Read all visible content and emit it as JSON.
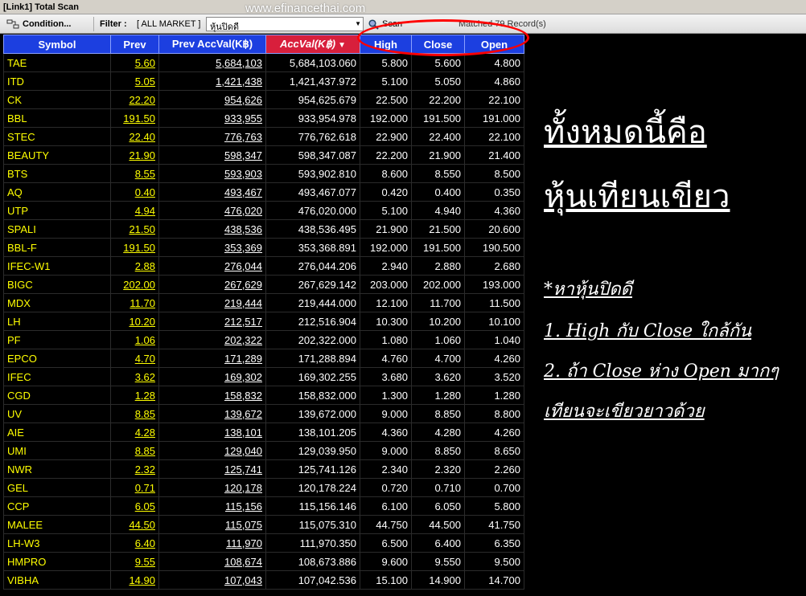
{
  "window": {
    "title": "[Link1] Total Scan"
  },
  "watermark": "www.efinancethai.com",
  "toolbar": {
    "condition_label": "Condition...",
    "filter_label": "Filter :",
    "filter_value": "[ ALL MARKET ]",
    "preset_value": "หุ้นปิดดี",
    "scan_label": "Scan",
    "matched_text": "Matched 79 Record(s)"
  },
  "columns": [
    "Symbol",
    "Prev",
    "Prev AccVal(K฿)",
    "AccVal(K฿)",
    "High",
    "Close",
    "Open"
  ],
  "rows": [
    [
      "TAE",
      "5.60",
      "5,684,103",
      "5,684,103.060",
      "5.800",
      "5.600",
      "4.800"
    ],
    [
      "ITD",
      "5.05",
      "1,421,438",
      "1,421,437.972",
      "5.100",
      "5.050",
      "4.860"
    ],
    [
      "CK",
      "22.20",
      "954,626",
      "954,625.679",
      "22.500",
      "22.200",
      "22.100"
    ],
    [
      "BBL",
      "191.50",
      "933,955",
      "933,954.978",
      "192.000",
      "191.500",
      "191.000"
    ],
    [
      "STEC",
      "22.40",
      "776,763",
      "776,762.618",
      "22.900",
      "22.400",
      "22.100"
    ],
    [
      "BEAUTY",
      "21.90",
      "598,347",
      "598,347.087",
      "22.200",
      "21.900",
      "21.400"
    ],
    [
      "BTS",
      "8.55",
      "593,903",
      "593,902.810",
      "8.600",
      "8.550",
      "8.500"
    ],
    [
      "AQ",
      "0.40",
      "493,467",
      "493,467.077",
      "0.420",
      "0.400",
      "0.350"
    ],
    [
      "UTP",
      "4.94",
      "476,020",
      "476,020.000",
      "5.100",
      "4.940",
      "4.360"
    ],
    [
      "SPALI",
      "21.50",
      "438,536",
      "438,536.495",
      "21.900",
      "21.500",
      "20.600"
    ],
    [
      "BBL-F",
      "191.50",
      "353,369",
      "353,368.891",
      "192.000",
      "191.500",
      "190.500"
    ],
    [
      "IFEC-W1",
      "2.88",
      "276,044",
      "276,044.206",
      "2.940",
      "2.880",
      "2.680"
    ],
    [
      "BIGC",
      "202.00",
      "267,629",
      "267,629.142",
      "203.000",
      "202.000",
      "193.000"
    ],
    [
      "MDX",
      "11.70",
      "219,444",
      "219,444.000",
      "12.100",
      "11.700",
      "11.500"
    ],
    [
      "LH",
      "10.20",
      "212,517",
      "212,516.904",
      "10.300",
      "10.200",
      "10.100"
    ],
    [
      "PF",
      "1.06",
      "202,322",
      "202,322.000",
      "1.080",
      "1.060",
      "1.040"
    ],
    [
      "EPCO",
      "4.70",
      "171,289",
      "171,288.894",
      "4.760",
      "4.700",
      "4.260"
    ],
    [
      "IFEC",
      "3.62",
      "169,302",
      "169,302.255",
      "3.680",
      "3.620",
      "3.520"
    ],
    [
      "CGD",
      "1.28",
      "158,832",
      "158,832.000",
      "1.300",
      "1.280",
      "1.280"
    ],
    [
      "UV",
      "8.85",
      "139,672",
      "139,672.000",
      "9.000",
      "8.850",
      "8.800"
    ],
    [
      "AIE",
      "4.28",
      "138,101",
      "138,101.205",
      "4.360",
      "4.280",
      "4.260"
    ],
    [
      "UMI",
      "8.85",
      "129,040",
      "129,039.950",
      "9.000",
      "8.850",
      "8.650"
    ],
    [
      "NWR",
      "2.32",
      "125,741",
      "125,741.126",
      "2.340",
      "2.320",
      "2.260"
    ],
    [
      "GEL",
      "0.71",
      "120,178",
      "120,178.224",
      "0.720",
      "0.710",
      "0.700"
    ],
    [
      "CCP",
      "6.05",
      "115,156",
      "115,156.146",
      "6.100",
      "6.050",
      "5.800"
    ],
    [
      "MALEE",
      "44.50",
      "115,075",
      "115,075.310",
      "44.750",
      "44.500",
      "41.750"
    ],
    [
      "LH-W3",
      "6.40",
      "111,970",
      "111,970.350",
      "6.500",
      "6.400",
      "6.350"
    ],
    [
      "HMPRO",
      "9.55",
      "108,674",
      "108,673.886",
      "9.600",
      "9.550",
      "9.500"
    ],
    [
      "VIBHA",
      "14.90",
      "107,043",
      "107,042.536",
      "15.100",
      "14.900",
      "14.700"
    ]
  ],
  "annotation": {
    "heading_line1": "ทั้งหมดนี้คือ",
    "heading_line2": "หุ้นเทียนเขียว",
    "tip_title": "*หาหุ้นปิดดี",
    "tip_1": "1. High กับ Close ใกล้กัน",
    "tip_2": "2. ถ้า Close ห่าง Open มากๆ",
    "tip_3": "เทียนจะเขียวยาวด้วย"
  },
  "colors": {
    "header_blue": "#1c3fe0",
    "sorted_header_red": "#d81f3c",
    "symbol_yellow": "#ffff00",
    "circle_red": "#ff0000"
  }
}
